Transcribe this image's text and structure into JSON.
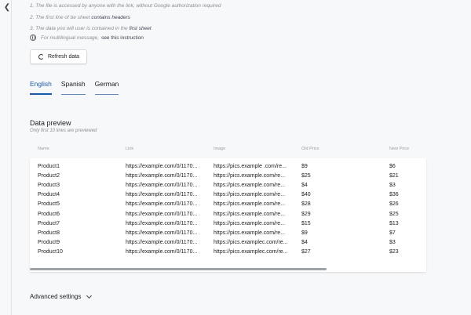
{
  "instructions": [
    {
      "prefix": "1. The file is accessed by anyone with the link, without Google authorization required",
      "bold": ""
    },
    {
      "prefix": "2. The first line of be sheet ",
      "bold": "contains headers"
    },
    {
      "prefix": "3. The data you will user is contained in the ",
      "bold": "first sheet"
    }
  ],
  "lang_note": {
    "text": "For multilingual message,",
    "link": "see this instruction"
  },
  "refresh_label": "Refresh data",
  "tabs": [
    "English",
    "Spanish",
    "German"
  ],
  "preview": {
    "title": "Data preview",
    "subtitle": "Only first 10 lines are previewed"
  },
  "table": {
    "columns": [
      "Name",
      "Link",
      "Image",
      "Old Price",
      "New Price"
    ],
    "rows": [
      [
        "Product1",
        "https://example.com/0/1170...",
        "https://pics.example .com/re...",
        "$9",
        "$6"
      ],
      [
        "Product2",
        "https://example.com/0/1170...",
        "https://pics.example.com/re...",
        "$25",
        "$21"
      ],
      [
        "Product3",
        "https://example.com/0/1170...",
        "https://pics.example.com/re...",
        "$4",
        "$3"
      ],
      [
        "Product4",
        "https://example.com/0/1170...",
        "https://pics.example.com/re...",
        "$40",
        "$36"
      ],
      [
        "Product5",
        "https://example.com/0/1170...",
        "https://pics.example.com/re...",
        "$28",
        "$26"
      ],
      [
        "Product6",
        "https://example.com/0/1170...",
        "https://pics.example.com/re...",
        "$29",
        "$25"
      ],
      [
        "Product7",
        "https://example.com/0/1170...",
        "https://pics.example.com/re...",
        "$15",
        "$13"
      ],
      [
        "Product8",
        "https://example.com/0/1170...",
        "https://pics.example.com/re...",
        "$9",
        "$7"
      ],
      [
        "Product9",
        "https://example.com/0/1170...",
        "https://pics.examplec.com/re...",
        "$4",
        "$3"
      ],
      [
        "Product10",
        "https://example.com/0/1170...",
        "https://pics.examplec.com/re...",
        "$27",
        "$23"
      ]
    ]
  },
  "advanced_label": "Advanced settings",
  "colors": {
    "accent": "#1a5aa6",
    "background": "#f7f8f9"
  }
}
